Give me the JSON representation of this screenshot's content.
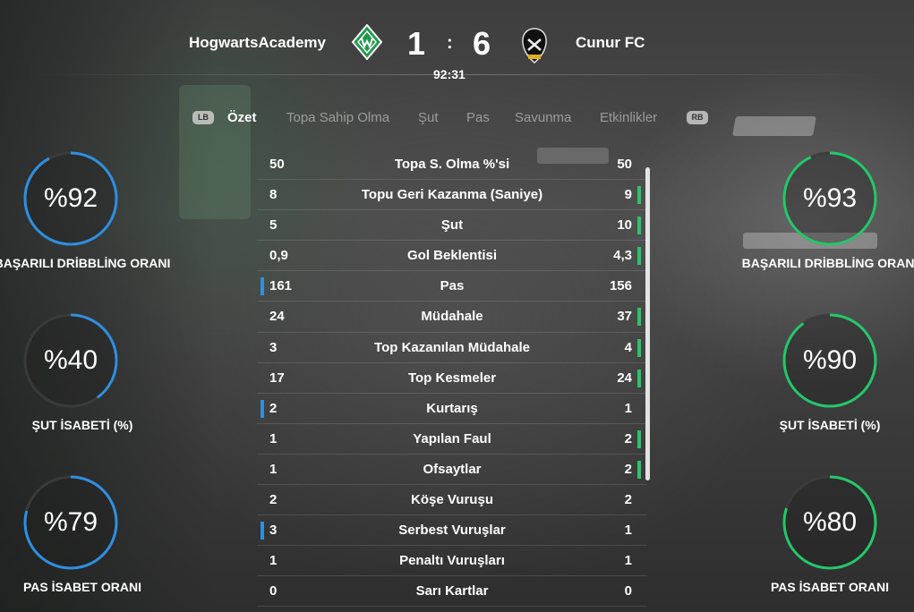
{
  "match": {
    "home_team": "HogwartsAcademy",
    "away_team": "Cunur FC",
    "home_score": "1",
    "separator": ":",
    "away_score": "6",
    "clock": "92:31"
  },
  "tabs": {
    "lb": "LB",
    "rb": "RB",
    "items": [
      "Özet",
      "Topa Sahip Olma",
      "Şut",
      "Pas",
      "Savunma",
      "Etkinlikler"
    ],
    "active": "Özet"
  },
  "colors": {
    "home_accent": "#2f8fe0",
    "away_accent": "#25c76a"
  },
  "home_rings": [
    {
      "value": "%92",
      "label": "BAŞARILI DRİBBLİNG ORANI",
      "percent": 92
    },
    {
      "value": "%40",
      "label": "ŞUT İSABETİ (%)",
      "percent": 40
    },
    {
      "value": "%79",
      "label": "PAS İSABET ORANI",
      "percent": 79
    }
  ],
  "away_rings": [
    {
      "value": "%93",
      "label": "BAŞARILI DRİBBLİNG ORANI",
      "percent": 93
    },
    {
      "value": "%90",
      "label": "ŞUT İSABETİ (%)",
      "percent": 90
    },
    {
      "value": "%80",
      "label": "PAS İSABET ORANI",
      "percent": 80
    }
  ],
  "stats": [
    {
      "name": "Topa S. Olma %'si",
      "home": "50",
      "away": "50",
      "leader": "none"
    },
    {
      "name": "Topu Geri Kazanma (Saniye)",
      "home": "8",
      "away": "9",
      "leader": "away"
    },
    {
      "name": "Şut",
      "home": "5",
      "away": "10",
      "leader": "away"
    },
    {
      "name": "Gol Beklentisi",
      "home": "0,9",
      "away": "4,3",
      "leader": "away"
    },
    {
      "name": "Pas",
      "home": "161",
      "away": "156",
      "leader": "home"
    },
    {
      "name": "Müdahale",
      "home": "24",
      "away": "37",
      "leader": "away"
    },
    {
      "name": "Top Kazanılan Müdahale",
      "home": "3",
      "away": "4",
      "leader": "away"
    },
    {
      "name": "Top Kesmeler",
      "home": "17",
      "away": "24",
      "leader": "away"
    },
    {
      "name": "Kurtarış",
      "home": "2",
      "away": "1",
      "leader": "home"
    },
    {
      "name": "Yapılan Faul",
      "home": "1",
      "away": "2",
      "leader": "away"
    },
    {
      "name": "Ofsaytlar",
      "home": "1",
      "away": "2",
      "leader": "away"
    },
    {
      "name": "Köşe Vuruşu",
      "home": "2",
      "away": "2",
      "leader": "none"
    },
    {
      "name": "Serbest Vuruşlar",
      "home": "3",
      "away": "1",
      "leader": "home"
    },
    {
      "name": "Penaltı Vuruşları",
      "home": "1",
      "away": "1",
      "leader": "none"
    },
    {
      "name": "Sarı Kartlar",
      "home": "0",
      "away": "0",
      "leader": "none"
    }
  ]
}
